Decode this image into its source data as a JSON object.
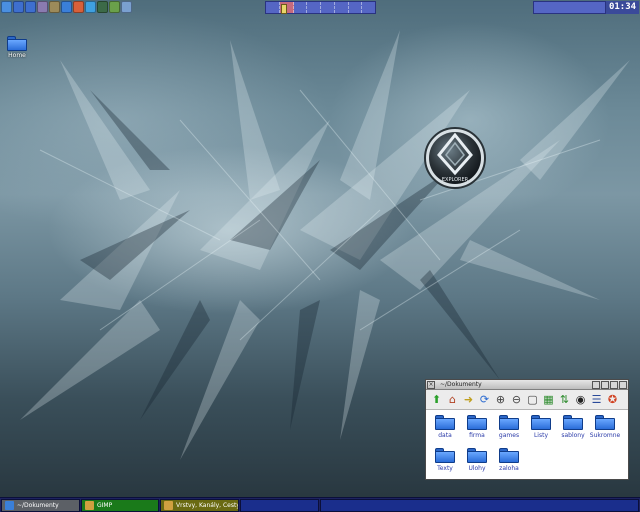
{
  "panel": {
    "launchers": [
      {
        "icon": "blue-star-icon",
        "color": "#4a8fe0"
      },
      {
        "icon": "fast-forward-icon",
        "color": "#3e6fcf"
      },
      {
        "icon": "play-icon",
        "color": "#3e6fcf"
      },
      {
        "icon": "people-icon",
        "color": "#8a7bb0"
      },
      {
        "icon": "gimp-icon",
        "color": "#9c8a5a"
      },
      {
        "icon": "arrow-up-icon",
        "color": "#3a7fd9"
      },
      {
        "icon": "network-icon",
        "color": "#d8603a"
      },
      {
        "icon": "document-icon",
        "color": "#3fa0e0"
      },
      {
        "icon": "printer-icon",
        "color": "#3c6a48"
      },
      {
        "icon": "tool-icon",
        "color": "#6aa04a"
      },
      {
        "icon": "display-icon",
        "color": "#7aa0d0"
      }
    ],
    "pager": {
      "desks": 8,
      "active": 1
    },
    "clock": "01:34"
  },
  "desktop": {
    "icons": [
      {
        "label": "Home"
      }
    ]
  },
  "emblem": {
    "text": "EXPLORER"
  },
  "file_manager": {
    "title": "~/Dokumenty",
    "toolbar": [
      {
        "icon": "up-arrow-icon"
      },
      {
        "icon": "home-icon"
      },
      {
        "icon": "forward-icon"
      },
      {
        "icon": "refresh-icon"
      },
      {
        "icon": "zoom-in-icon"
      },
      {
        "icon": "zoom-out-icon"
      },
      {
        "icon": "select-icon"
      },
      {
        "icon": "sort-icon"
      },
      {
        "icon": "sort-az-icon"
      },
      {
        "icon": "eye-icon"
      },
      {
        "icon": "list-view-icon"
      },
      {
        "icon": "help-icon"
      }
    ],
    "items": [
      {
        "label": "data"
      },
      {
        "label": "firma"
      },
      {
        "label": "games"
      },
      {
        "label": "Listy"
      },
      {
        "label": "sablony"
      },
      {
        "label": "Sukromne"
      },
      {
        "label": "Texty"
      },
      {
        "label": "Ulohy"
      },
      {
        "label": "zaloha"
      }
    ]
  },
  "taskbar": {
    "tasks": [
      {
        "label": "~/Dokumenty",
        "icon": "folder-icon",
        "color": "#3a7fd9"
      },
      {
        "label": "GIMP",
        "icon": "gimp-icon",
        "color": "#d0a040"
      },
      {
        "label": "Vrstvy, Kanály, Cesty",
        "icon": "gimp-icon",
        "color": "#d0a040"
      },
      {
        "label": "",
        "icon": "",
        "color": ""
      },
      {
        "label": "",
        "icon": "",
        "color": ""
      }
    ]
  }
}
